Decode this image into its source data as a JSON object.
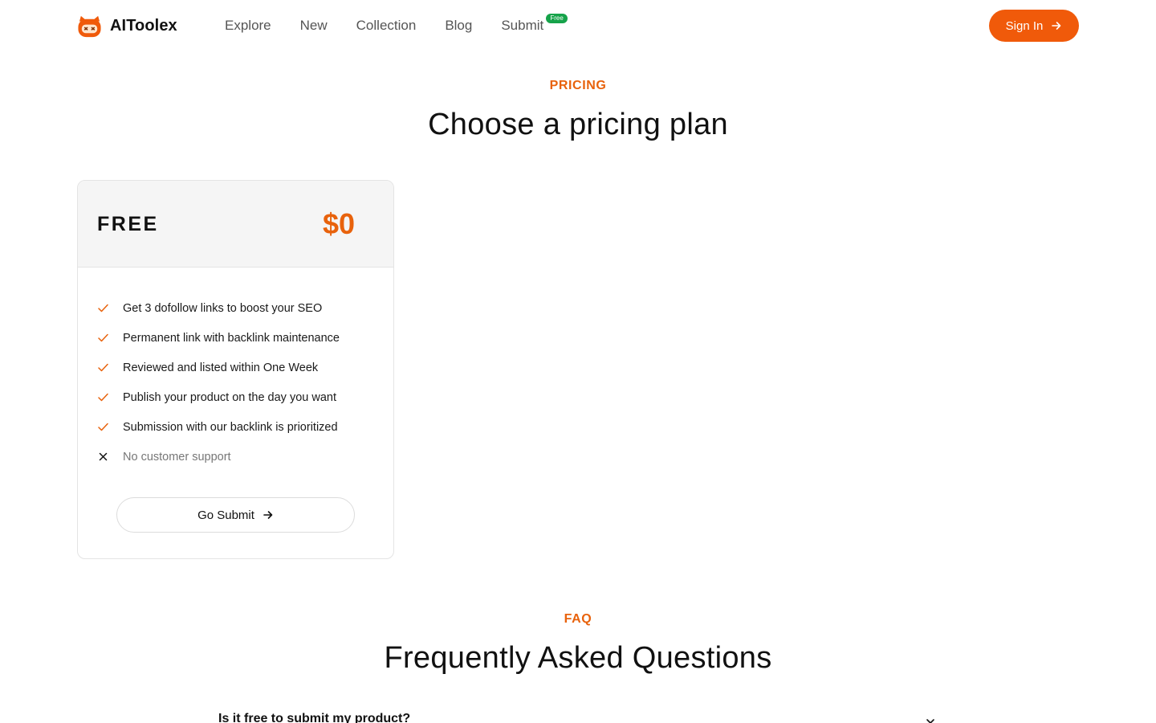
{
  "brand": {
    "name": "AIToolex",
    "logo_icon": "robot-cat-icon",
    "accent_color": "#f05a0a"
  },
  "nav": {
    "items": [
      {
        "label": "Explore"
      },
      {
        "label": "New"
      },
      {
        "label": "Collection"
      },
      {
        "label": "Blog"
      },
      {
        "label": "Submit",
        "badge": "Free"
      }
    ],
    "badge_color": "#16a34a"
  },
  "header": {
    "signin_label": "Sign In",
    "signin_icon": "arrow-right-icon"
  },
  "pricing": {
    "eyebrow": "PRICING",
    "title": "Choose a pricing plan",
    "plans": [
      {
        "name": "FREE",
        "price": "$0",
        "features": [
          {
            "text": "Get 3 dofollow links to boost your SEO",
            "included": true
          },
          {
            "text": "Permanent link with backlink maintenance",
            "included": true
          },
          {
            "text": "Reviewed and listed within One Week",
            "included": true
          },
          {
            "text": "Publish your product on the day you want",
            "included": true
          },
          {
            "text": "Submission with our backlink is prioritized",
            "included": true
          },
          {
            "text": "No customer support",
            "included": false
          }
        ],
        "cta_label": "Go Submit",
        "cta_icon": "arrow-right-icon"
      }
    ]
  },
  "faq": {
    "eyebrow": "FAQ",
    "title": "Frequently Asked Questions",
    "items": [
      {
        "question": "Is it free to submit my product?",
        "icon": "close-icon"
      }
    ]
  }
}
